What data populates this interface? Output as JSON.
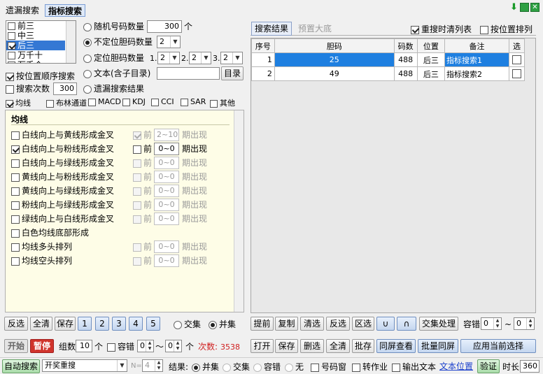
{
  "tabs": [
    "遗漏搜索",
    "指标搜索"
  ],
  "top_icons": [
    "download-arrow-icon",
    "maximize-icon",
    "close-icon"
  ],
  "position_list": [
    "前三",
    "中三",
    "后三",
    "万千十",
    "万千个"
  ],
  "position_checked": [
    false,
    false,
    true,
    false,
    false
  ],
  "options": {
    "random_count_label": "随机号码数量",
    "random_count_value": "300",
    "random_count_unit": "个",
    "unfixed_count_label": "不定位胆码数量",
    "unfixed_count_value": "2",
    "fixed_label": "定位胆码数量",
    "fixed_values": [
      {
        "prefix": "1.",
        "value": "2"
      },
      {
        "prefix": "2.",
        "value": "2"
      },
      {
        "prefix": "3.",
        "value": "2"
      }
    ],
    "text_label": "文本(含子目录)",
    "catalog_button": "目录",
    "order_search_label": "按位置顺序搜索",
    "search_times_label": "搜索次数",
    "search_times_value": "300",
    "missing_result_label": "遗漏搜索结果"
  },
  "indicator_tabs": [
    "均线",
    "布林通道",
    "MACD",
    "KDJ",
    "CCI",
    "SAR",
    "其他"
  ],
  "indicator_checked": [
    true,
    false,
    false,
    false,
    false,
    false,
    false
  ],
  "ma_panel": {
    "title": "均线",
    "before_label": "前",
    "period_label": "期出现",
    "rows": [
      {
        "label": "白线向上与黄线形成金叉",
        "checked": false,
        "pre_checked": true,
        "range": "2~10",
        "enabled": false
      },
      {
        "label": "白线向上与粉线形成金叉",
        "checked": true,
        "pre_checked": false,
        "range": "0~0",
        "enabled": true
      },
      {
        "label": "白线向上与绿线形成金叉",
        "checked": false,
        "pre_checked": false,
        "range": "0~0",
        "enabled": false
      },
      {
        "label": "黄线向上与粉线形成金叉",
        "checked": false,
        "pre_checked": false,
        "range": "0~0",
        "enabled": false
      },
      {
        "label": "黄线向上与绿线形成金叉",
        "checked": false,
        "pre_checked": false,
        "range": "0~0",
        "enabled": false
      },
      {
        "label": "粉线向上与绿线形成金叉",
        "checked": false,
        "pre_checked": false,
        "range": "0~0",
        "enabled": false
      },
      {
        "label": "绿线向上与白线形成金叉",
        "checked": false,
        "pre_checked": false,
        "range": "0~0",
        "enabled": false
      },
      {
        "label": "白色均线底部形成",
        "checked": false,
        "pre_checked": null,
        "range": null,
        "enabled": false
      },
      {
        "label": "均线多头排列",
        "checked": false,
        "pre_checked": false,
        "range": "0~0",
        "enabled": false
      },
      {
        "label": "均线空头排列",
        "checked": false,
        "pre_checked": false,
        "range": "0~0",
        "enabled": false
      }
    ]
  },
  "left_buttons": [
    "反选",
    "全清",
    "保存",
    "1",
    "2",
    "3",
    "4",
    "5"
  ],
  "set_mode": {
    "intersection": "交集",
    "union": "并集",
    "selected": "union"
  },
  "run_bar": {
    "start": "开始",
    "pause": "暂停",
    "group_label": "组数",
    "group_value": "10",
    "group_unit": "个",
    "tolerance_label": "容错",
    "tol_from": "0",
    "tol_to": "0",
    "tol_unit": "个",
    "count_label": "次数:",
    "count_value": "3538"
  },
  "result_tabs": [
    "搜索结果",
    "预置大底"
  ],
  "result_options": {
    "clear_on_search": "重搜时清列表",
    "clear_checked": true,
    "sort_by_pos": "按位置排列",
    "sort_checked": false
  },
  "table": {
    "headers": [
      "序号",
      "胆码",
      "码数",
      "位置",
      "备注",
      "选"
    ],
    "rows": [
      {
        "index": "1",
        "code": "25",
        "count": "488",
        "pos": "后三",
        "note": "指标搜索1",
        "selected": true
      },
      {
        "index": "2",
        "code": "49",
        "count": "488",
        "pos": "后三",
        "note": "指标搜索2",
        "selected": false
      }
    ]
  },
  "right_buttons_row1": [
    "提前",
    "复制",
    "清选",
    "反选",
    "区选",
    "∪",
    "∩",
    "交集处理"
  ],
  "right_tol": {
    "label": "容错",
    "from": "0",
    "to": "0",
    "sep": "~"
  },
  "right_buttons_row2": [
    "打开",
    "保存",
    "删选",
    "全清",
    "批存",
    "同屏查看",
    "批量同屏",
    "应用当前选择"
  ],
  "status": {
    "auto_search": "自动搜索",
    "mode": "开奖重搜",
    "n_label": "N=",
    "n_value": "4",
    "result_label": "结果:",
    "result_opts": [
      "并集",
      "交集",
      "容错",
      "无"
    ],
    "result_selected": 0,
    "number_window": "号码窗",
    "to_homework": "转作业",
    "output_text": "输出文本",
    "text_position": "文本位置",
    "verify": "验证",
    "duration_label": "时长",
    "duration_value": "360"
  }
}
